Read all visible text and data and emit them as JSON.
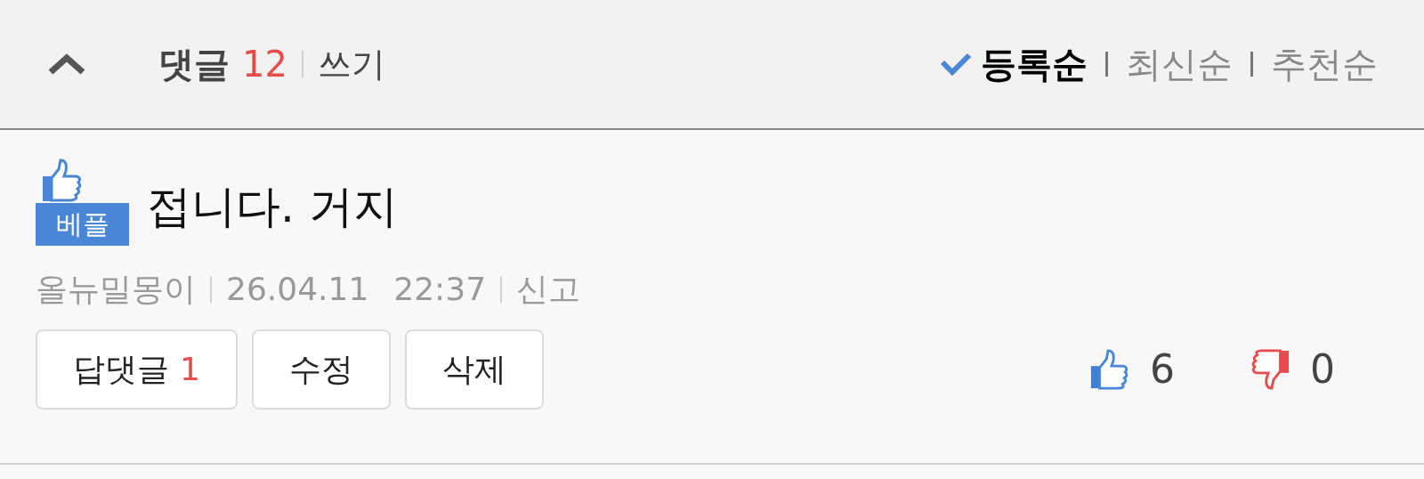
{
  "header": {
    "title": "댓글",
    "count": "12",
    "write_link": "쓰기"
  },
  "sort_options": [
    {
      "label": "등록순",
      "selected": true
    },
    {
      "label": "최신순",
      "selected": false
    },
    {
      "label": "추천순",
      "selected": false
    }
  ],
  "comment": {
    "badge": "베플",
    "text": "접니다. 거지",
    "author": "올뉴밀몽이",
    "date": "26.04.11",
    "time": "22:37",
    "report": "신고",
    "buttons": [
      {
        "label": "답댓글",
        "count": "1"
      },
      {
        "label": "수정"
      },
      {
        "label": "삭제"
      }
    ],
    "likes": "6",
    "dislikes": "0"
  }
}
